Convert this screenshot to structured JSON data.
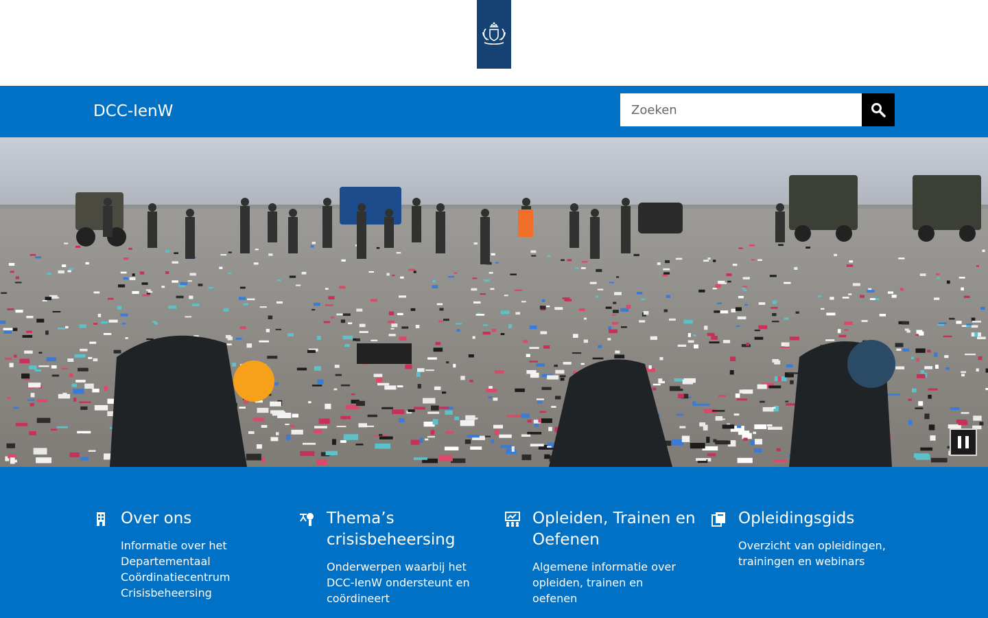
{
  "header": {
    "site_title": "DCC-IenW",
    "search": {
      "placeholder": "Zoeken",
      "button_icon": "magnifier-icon"
    }
  },
  "logo": {
    "icon": "rijksoverheid-coat-of-arms-logo",
    "color": "#154273"
  },
  "hero": {
    "pause_icon": "pause-icon",
    "image_description_icon": "beach-cleanup-photo"
  },
  "colors": {
    "brand_blue": "#0071c5",
    "logo_navy": "#154273",
    "search_button": "#000000"
  },
  "features": [
    {
      "icon": "building-icon",
      "title": "Over ons",
      "description": "Informatie over het Departementaal Coördinatiecentrum Crisisbeheersing"
    },
    {
      "icon": "emergency-themes-icon",
      "title": "Thema’s crisisbeheersing",
      "description": "Onderwerpen waarbij het DCC-IenW ondersteunt en coördineert"
    },
    {
      "icon": "training-icon",
      "title": "Opleiden, Trainen en Oefenen",
      "description": "Algemene informatie over opleiden, trainen en oefenen"
    },
    {
      "icon": "guide-book-icon",
      "title": "Opleidingsgids",
      "description": "Overzicht van opleidingen, trainingen en webinars"
    }
  ]
}
